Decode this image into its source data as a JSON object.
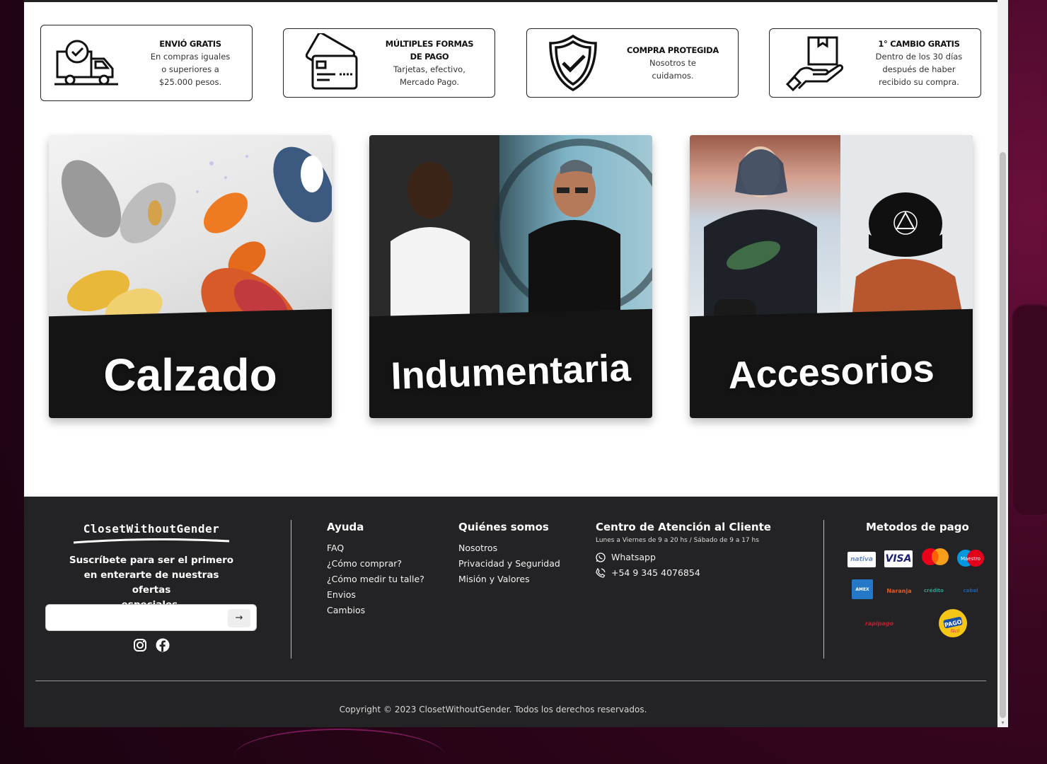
{
  "benefits": [
    {
      "title": "ENVIÓ GRATIS",
      "lines": [
        "En compras iguales",
        "o superiores a",
        "$25.000 pesos."
      ],
      "icon": "truck-icon"
    },
    {
      "title": "MÚLTIPLES FORMAS DE PAGO",
      "title_lines": [
        "MÚLTIPLES FORMAS",
        "DE PAGO"
      ],
      "lines": [
        "Tarjetas, efectivo,",
        "Mercado Pago."
      ],
      "icon": "credit-cards-icon"
    },
    {
      "title": "COMPRA PROTEGIDA",
      "lines": [
        "Nosotros te",
        "cuidamos."
      ],
      "icon": "shield-check-icon"
    },
    {
      "title": "1° CAMBIO GRATIS",
      "lines": [
        "Dentro de los 30 días",
        "después de haber",
        "recibido su compra."
      ],
      "icon": "box-hand-icon"
    }
  ],
  "categories": [
    {
      "label": "Calzado"
    },
    {
      "label": "Indumentaria"
    },
    {
      "label": "Accesorios"
    }
  ],
  "footer": {
    "brand": "ClosetWithoutGender",
    "subscribe_lines": [
      "Suscríbete para ser el primero",
      "en enterarte de nuestras ofertas",
      "especiales."
    ],
    "email_placeholder": "",
    "submit_arrow": "→",
    "help": {
      "title": "Ayuda",
      "links": [
        "FAQ",
        "¿Cómo comprar?",
        "¿Cómo medir tu talle?",
        "Envios",
        "Cambios"
      ]
    },
    "about": {
      "title": "Quiénes somos",
      "links": [
        "Nosotros",
        "Privacidad y Seguridad",
        "Misión y Valores"
      ]
    },
    "support": {
      "title": "Centro de Atención al Cliente",
      "hours": "Lunes a Viernes de 9 a 20 hs / Sábado de 9 a 17 hs",
      "whatsapp": "Whatsapp",
      "phone": "+54 9 345 4076854"
    },
    "payments": {
      "title": "Metodos de pago",
      "methods": [
        "nativa",
        "VISA",
        "Mastercard",
        "Maestro",
        "American Express",
        "Naranja",
        "Crédito",
        "Cabal",
        "rapipago",
        "Pago Fácil"
      ]
    },
    "copyright": "Copyright © 2023 ClosetWithoutGender. Todos los derechos reservados."
  },
  "colors": {
    "footer_bg": "#232325",
    "accent_dark": "#141414",
    "page_bg": "#2a0418"
  }
}
